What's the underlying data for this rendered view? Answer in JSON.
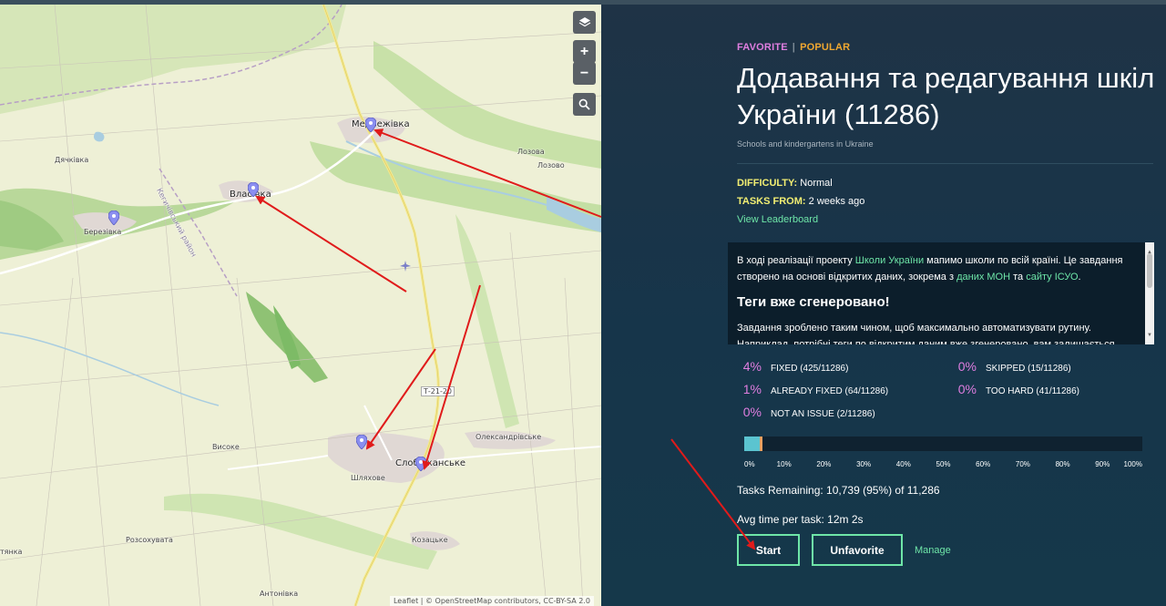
{
  "map": {
    "labels": {
      "medvezhivka": "Медвежівка",
      "vlasivka": "Власівка",
      "dyachkivka": "Дячківка",
      "berezivka": "Березівка",
      "lozova": "Лозова",
      "lozovo": "Лозово",
      "vysoke": "Високе",
      "slobozhanske": "Слобожанське",
      "shlyakhove": "Шляхове",
      "oleksandrivske": "Олександрівське",
      "road": "Т-21-20",
      "rozsokhuvata": "Розсохувата",
      "kozatske": "Козацьке",
      "antonivka": "Антонівка",
      "yatyanka": "тянка",
      "district": "Кегичівський район"
    },
    "controls": {
      "layers": "≡",
      "zoom_in": "+",
      "zoom_out": "−",
      "search": "⌕"
    },
    "attribution": "Leaflet | © OpenStreetMap contributors, CC-BY-SA 2.0"
  },
  "panel": {
    "tag_favorite": "FAVORITE",
    "tag_separator": "|",
    "tag_popular": "POPULAR",
    "title": "Додавання та редагування шкіл України (11286)",
    "subtitle": "Schools and kindergartens in Ukraine",
    "difficulty_label": "DIFFICULTY:",
    "difficulty_value": "Normal",
    "tasks_from_label": "TASKS FROM:",
    "tasks_from_value": "2 weeks ago",
    "leaderboard_link": "View Leaderboard",
    "description": {
      "p1_a": "В ході реалізації проекту ",
      "p1_link1": "Школи України",
      "p1_b": " мапимо школи по всій країні. Це завдання створено на основі відкритих даних, зокрема з ",
      "p1_link2": "даних МОН",
      "p1_c": " та ",
      "p1_link3": "сайту ІСУО",
      "p1_d": ".",
      "heading": "Теги вже сгенеровано!",
      "p2": "Завдання зроблено таким чином, щоб максимально автоматизувати рутину.",
      "p3": "Наприклад, потрібні теги по відкритим даним вже згенеровано, вам залишається"
    },
    "stats": [
      {
        "pct": "4%",
        "label": "FIXED (425/11286)"
      },
      {
        "pct": "0%",
        "label": "SKIPPED (15/11286)"
      },
      {
        "pct": "1%",
        "label": "ALREADY FIXED (64/11286)"
      },
      {
        "pct": "0%",
        "label": "TOO HARD (41/11286)"
      },
      {
        "pct": "0%",
        "label": "NOT AN ISSUE (2/11286)"
      }
    ],
    "progress": {
      "fixed_fraction": 0.038,
      "already_fixed_fraction": 0.006,
      "colors": {
        "fixed": "#5bc4d0",
        "already_fixed": "#e8a060",
        "track": "#0f2230"
      },
      "ticks": [
        "0%",
        "10%",
        "20%",
        "30%",
        "40%",
        "50%",
        "60%",
        "70%",
        "80%",
        "90%",
        "100%"
      ]
    },
    "tasks_remaining": "Tasks Remaining: 10,739 (95%) of 11,286",
    "avg_time": "Avg time per task:  12m 2s",
    "start_label": "Start",
    "unfavorite_label": "Unfavorite",
    "manage_label": "Manage"
  },
  "colors": {
    "accent_green": "#6ee6a8",
    "favorite_pink": "#e07ee0",
    "popular_orange": "#f0a830",
    "label_yellow": "#f2ee72",
    "annotation_red": "#e01b1b"
  },
  "icons": {
    "layers": "layers-icon",
    "zoom_in": "plus-icon",
    "zoom_out": "minus-icon",
    "search": "search-icon",
    "pin": "map-pin-icon"
  }
}
